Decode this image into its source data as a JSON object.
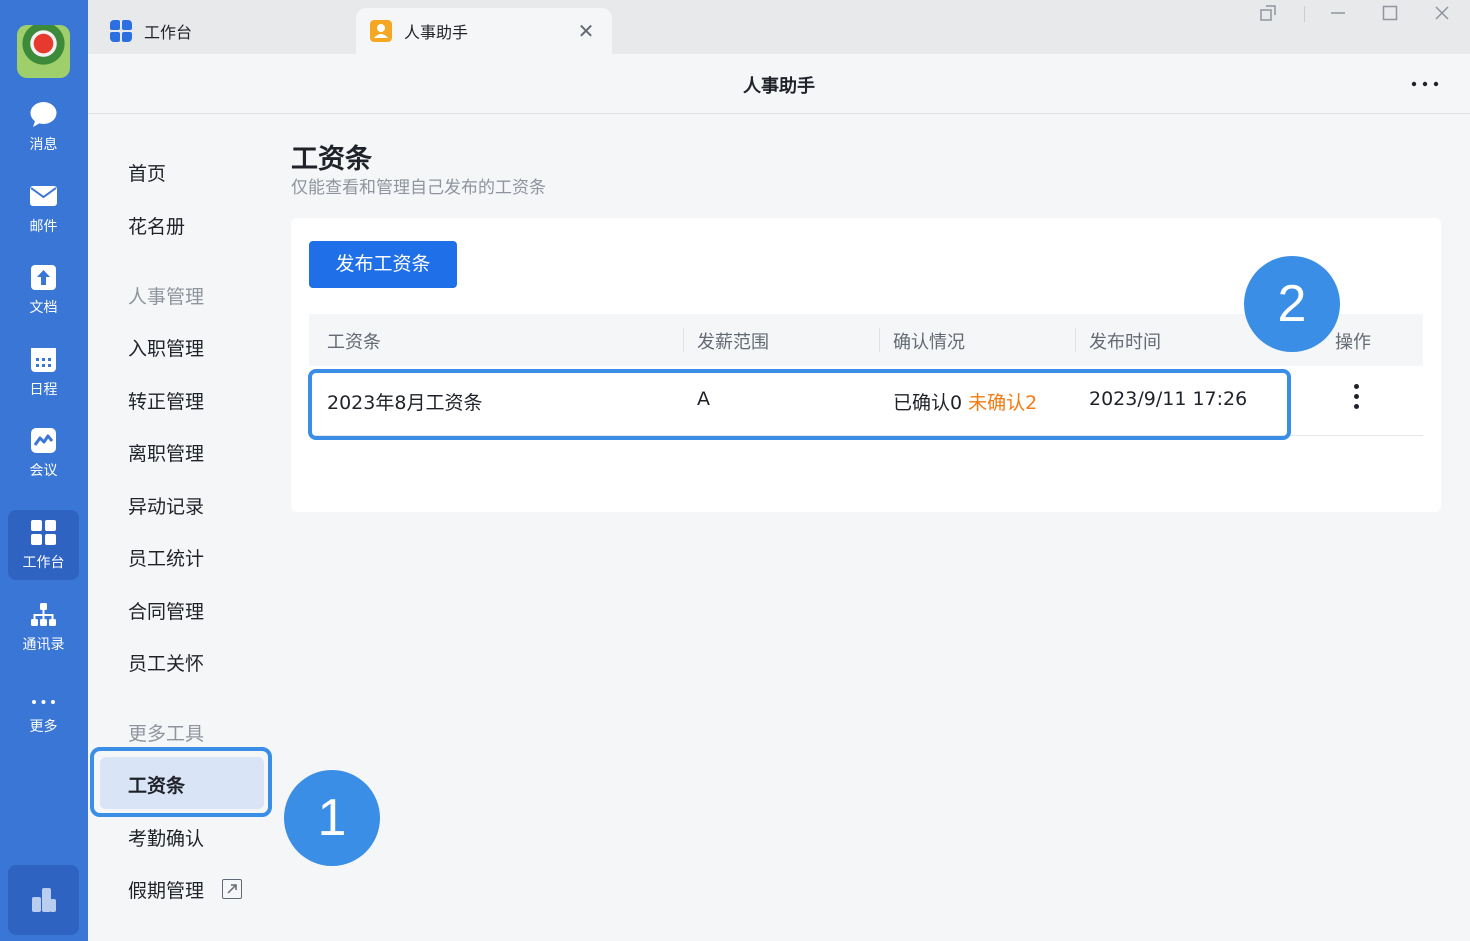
{
  "dock": {
    "items": [
      {
        "label": "消息",
        "icon": "chat-bubble-icon"
      },
      {
        "label": "邮件",
        "icon": "mail-icon"
      },
      {
        "label": "文档",
        "icon": "docs-icon"
      },
      {
        "label": "日程",
        "icon": "calendar-icon"
      },
      {
        "label": "会议",
        "icon": "meeting-icon"
      },
      {
        "label": "工作台",
        "icon": "grid-icon"
      },
      {
        "label": "通讯录",
        "icon": "org-chart-icon"
      },
      {
        "label": "更多",
        "icon": "more-dots-icon"
      }
    ]
  },
  "tabs": [
    {
      "label": "工作台",
      "icon": "grid-icon"
    },
    {
      "label": "人事助手",
      "icon": "person-icon"
    }
  ],
  "title": "人事助手",
  "nav": {
    "home": "首页",
    "roster": "花名册",
    "group_hr": "人事管理",
    "onboarding": "入职管理",
    "regularization": "转正管理",
    "offboarding": "离职管理",
    "changes": "异动记录",
    "stats": "员工统计",
    "contracts": "合同管理",
    "care": "员工关怀",
    "group_tools": "更多工具",
    "payslip": "工资条",
    "attendance": "考勤确认",
    "leave": "假期管理"
  },
  "page": {
    "title": "工资条",
    "subtitle": "仅能查看和管理自己发布的工资条",
    "publish_button": "发布工资条"
  },
  "table": {
    "headers": {
      "name": "工资条",
      "scope": "发薪范围",
      "confirm": "确认情况",
      "time": "发布时间",
      "ops": "操作"
    },
    "rows": [
      {
        "name": "2023年8月工资条",
        "scope": "A",
        "confirmed": "已确认0",
        "unconfirmed": "未确认2",
        "time": "2023/9/11 17:26"
      }
    ]
  },
  "annotations": {
    "badge1": "1",
    "badge2": "2"
  },
  "colors": {
    "dock": "#3a76d6",
    "primary": "#1e6fe8",
    "highlight": "#3a8ee6",
    "warning": "#f57a10"
  }
}
